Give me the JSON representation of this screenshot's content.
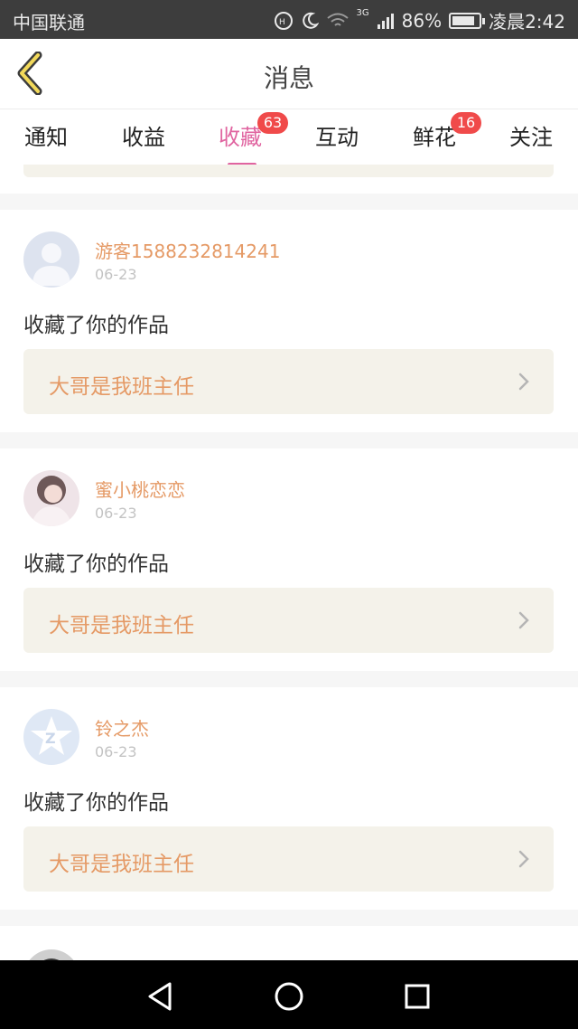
{
  "status_bar": {
    "carrier": "中国联通",
    "network": "3G",
    "battery": "86%",
    "battery_level": 0.86,
    "time": "凌晨2:42"
  },
  "header": {
    "title": "消息"
  },
  "tabs": [
    {
      "label": "通知",
      "badge": null,
      "active": false
    },
    {
      "label": "收益",
      "badge": null,
      "active": false
    },
    {
      "label": "收藏",
      "badge": "63",
      "active": true
    },
    {
      "label": "互动",
      "badge": null,
      "active": false
    },
    {
      "label": "鲜花",
      "badge": "16",
      "active": false
    },
    {
      "label": "关注",
      "badge": null,
      "active": false
    }
  ],
  "feed": [
    {
      "user": "游客1588232814241",
      "date": "06-23",
      "action": "收藏了你的作品",
      "work_title": "大哥是我班主任",
      "avatar": "default-person-avatar"
    },
    {
      "user": "蜜小桃恋恋",
      "date": "06-23",
      "action": "收藏了你的作品",
      "work_title": "大哥是我班主任",
      "avatar": "photo-avatar"
    },
    {
      "user": "铃之杰",
      "date": "06-23",
      "action": "收藏了你的作品",
      "work_title": "大哥是我班主任",
      "avatar": "default-star-avatar"
    }
  ],
  "colors": {
    "accent_pink": "#e064a0",
    "name_orange": "#e59a66",
    "badge_red": "#f04a4a",
    "work_bg": "#f4f2ea"
  }
}
